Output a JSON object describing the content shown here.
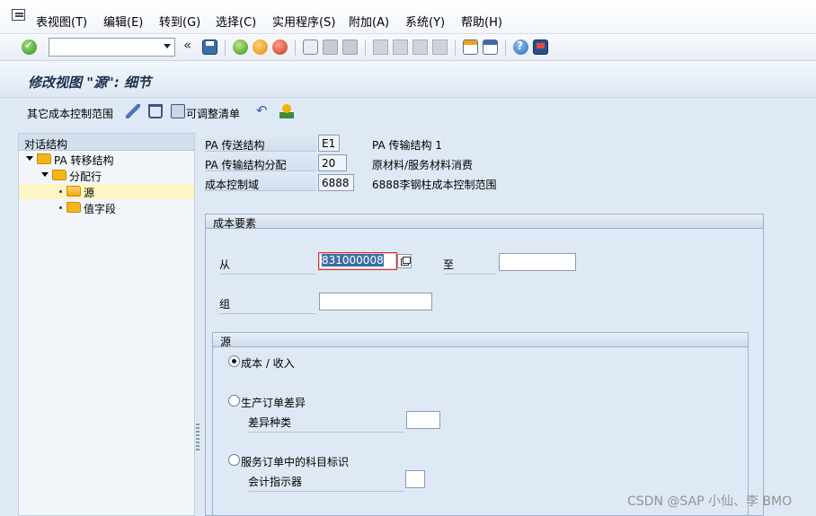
{
  "menu": {
    "items": [
      "表视图(T)",
      "编辑(E)",
      "转到(G)",
      "选择(C)",
      "实用程序(S)",
      "附加(A)",
      "系统(Y)",
      "帮助(H)"
    ]
  },
  "toolbar": {
    "command_value": "",
    "icons": [
      "enter-check",
      "save",
      "back",
      "exit",
      "cancel",
      "print",
      "find",
      "find-next",
      "first-page",
      "previous-page",
      "next-page",
      "last-page",
      "new-session",
      "shortcut",
      "help",
      "customize-layout"
    ]
  },
  "title": "修改视图 \"源\": 细节",
  "app_toolbar": {
    "other_area_label": "其它成本控制范围",
    "adjustable_list_label": "可调整清单"
  },
  "tree": {
    "header": "对话结构",
    "nodes": [
      {
        "label": "PA 转移结构",
        "level": 0,
        "expanded": true
      },
      {
        "label": "分配行",
        "level": 1,
        "expanded": true
      },
      {
        "label": "源",
        "level": 2,
        "selected": true
      },
      {
        "label": "值字段",
        "level": 2
      }
    ]
  },
  "header_fields": [
    {
      "label": "PA 传送结构",
      "value": "E1",
      "text": "PA 传输结构 1"
    },
    {
      "label": "PA 传输结构分配",
      "value": "20",
      "text": "原材料/服务材料消费"
    },
    {
      "label": "成本控制域",
      "value": "6888",
      "text": "6888李钢柱成本控制范围"
    }
  ],
  "cost_element_group": {
    "title": "成本要素",
    "from_label": "从",
    "from_value": "831000008",
    "to_label": "至",
    "to_value": "",
    "group_label": "组",
    "group_value": ""
  },
  "source_group": {
    "title": "源",
    "options": [
      {
        "label": "成本 / 收入",
        "selected": true
      },
      {
        "label": "生产订单差异",
        "selected": false,
        "sub_label": "差异种类",
        "sub_value": ""
      },
      {
        "label": "服务订单中的科目标识",
        "selected": false,
        "sub_label": "会计指示器",
        "sub_value": ""
      }
    ]
  },
  "watermark": "CSDN @SAP 小仙、李 BMO"
}
